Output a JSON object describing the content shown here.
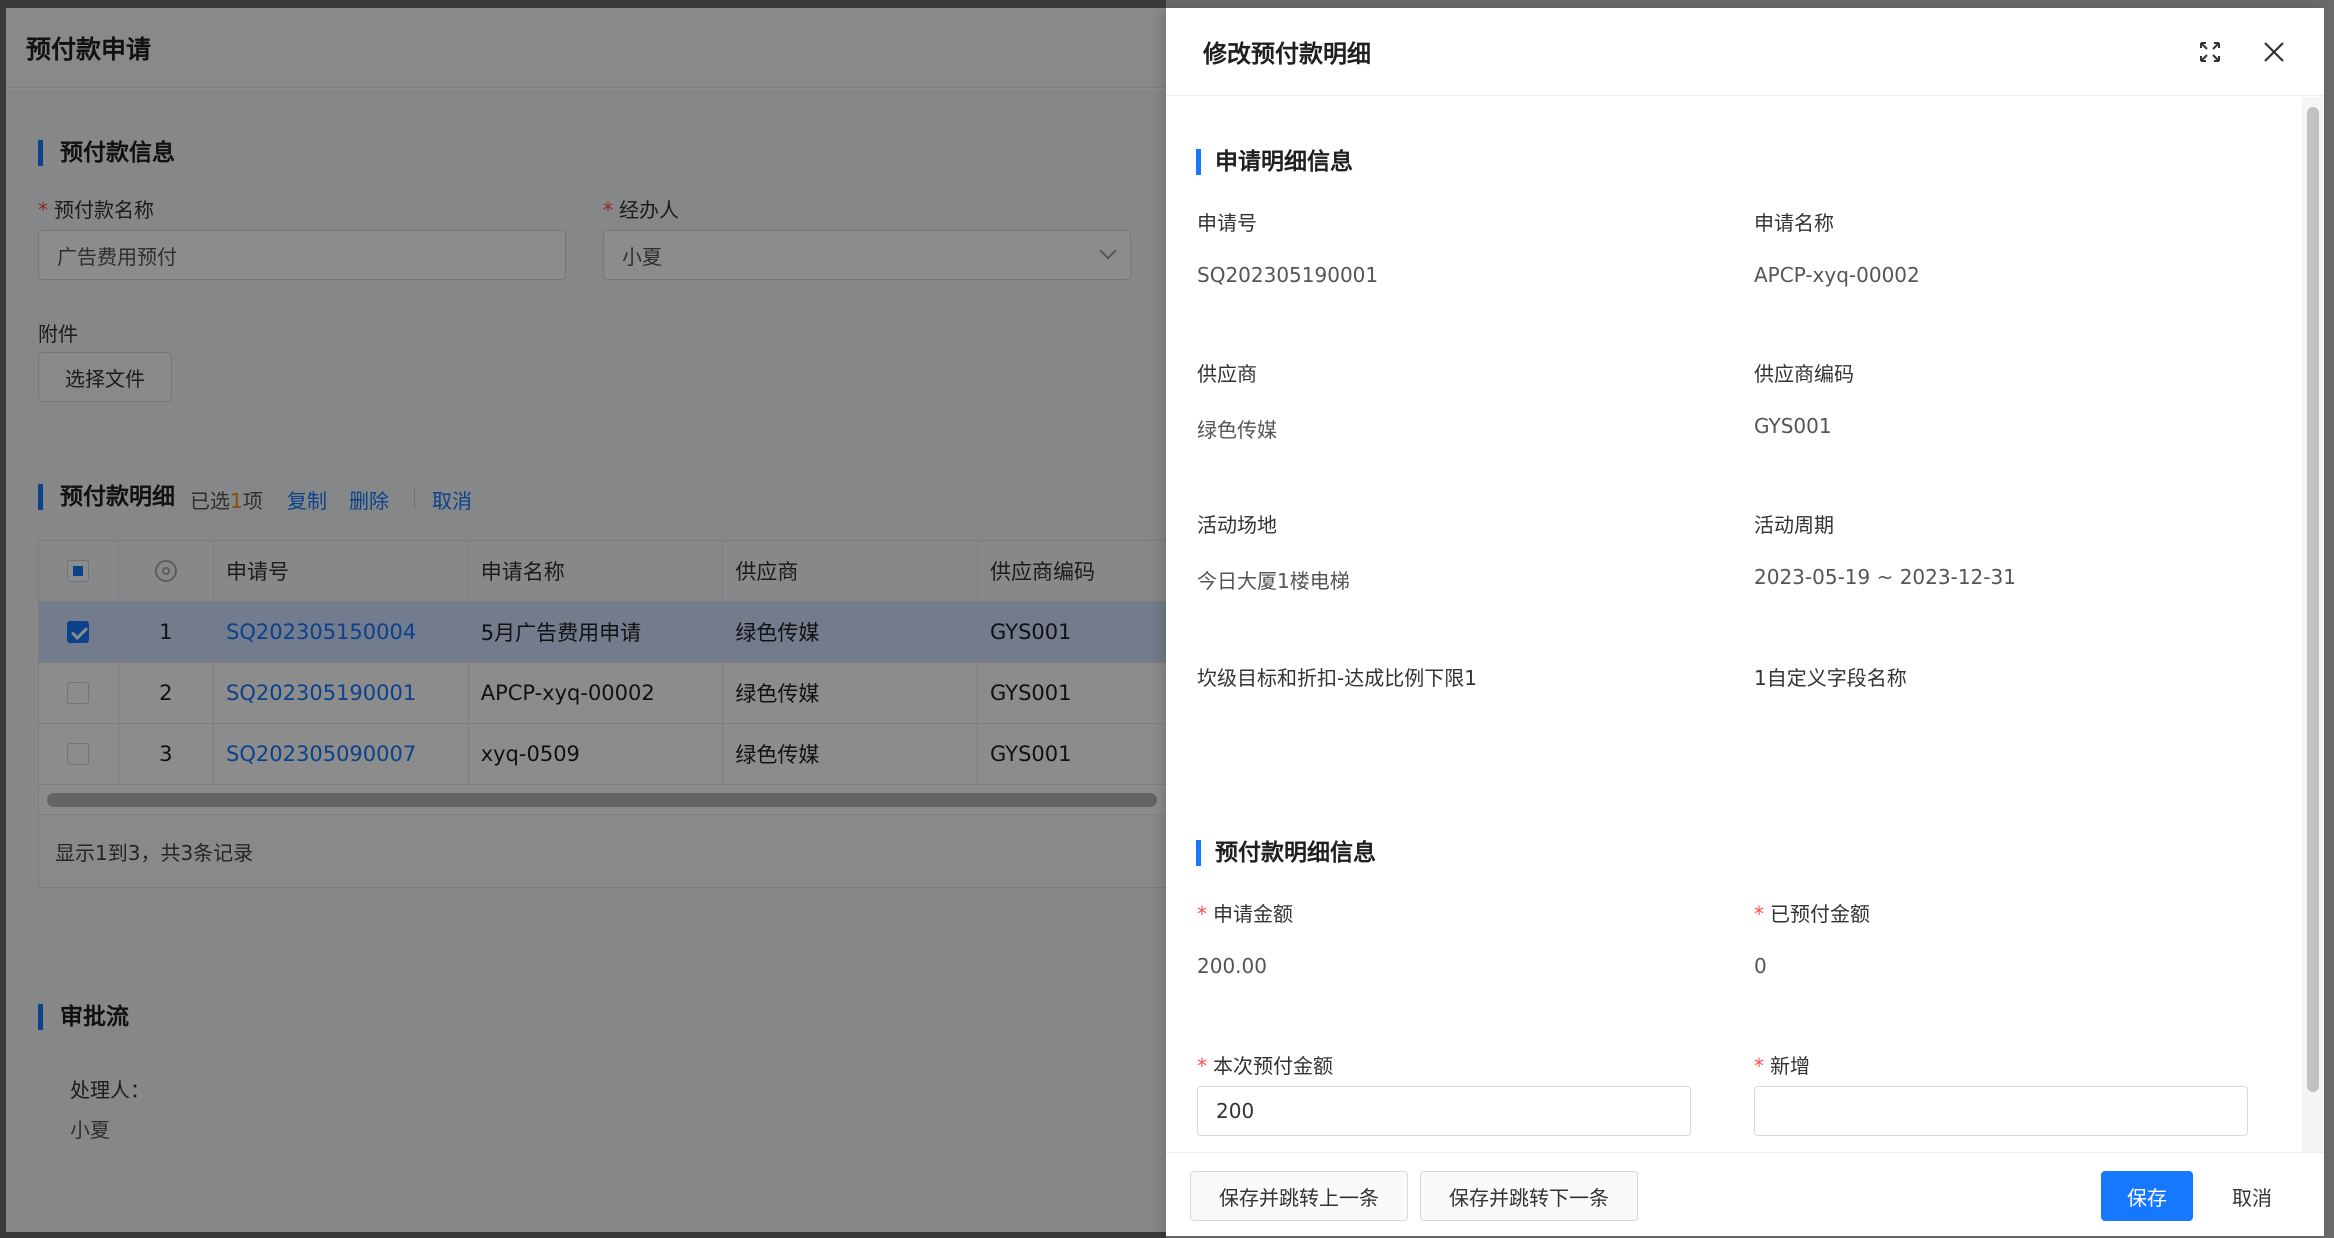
{
  "page": {
    "title": "预付款申请",
    "info_section": "预付款信息",
    "name_label": "预付款名称",
    "name_value": "广告费用预付",
    "handler_label": "经办人",
    "handler_value": "小夏",
    "attach_label": "附件",
    "attach_button": "选择文件",
    "detail_section": "预付款明细",
    "selected_prefix": "已选",
    "selected_count": "1",
    "selected_suffix": "项",
    "copy_link": "复制",
    "delete_link": "删除",
    "cancel_link": "取消",
    "table": {
      "headers": [
        "申请号",
        "申请名称",
        "供应商",
        "供应商编码"
      ],
      "rows": [
        {
          "no": "1",
          "id": "SQ202305150004",
          "name": "5月广告费用申请",
          "supplier": "绿色传媒",
          "code": "GYS001",
          "checked": true
        },
        {
          "no": "2",
          "id": "SQ202305190001",
          "name": "APCP-xyq-00002",
          "supplier": "绿色传媒",
          "code": "GYS001",
          "checked": false
        },
        {
          "no": "3",
          "id": "SQ202305090007",
          "name": "xyq-0509",
          "supplier": "绿色传媒",
          "code": "GYS001",
          "checked": false
        }
      ],
      "footer": "显示1到3，共3条记录"
    },
    "approval_section": "审批流",
    "processor_label": "处理人：",
    "processor_value": "小夏"
  },
  "drawer": {
    "title": "修改预付款明细",
    "section1": "申请明细信息",
    "fields1": {
      "apply_no_label": "申请号",
      "apply_no": "SQ202305190001",
      "apply_name_label": "申请名称",
      "apply_name": "APCP-xyq-00002",
      "supplier_label": "供应商",
      "supplier": "绿色传媒",
      "supplier_code_label": "供应商编码",
      "supplier_code": "GYS001",
      "venue_label": "活动场地",
      "venue": "今日大厦1楼电梯",
      "period_label": "活动周期",
      "period": "2023-05-19 ~ 2023-12-31",
      "custom1_label": "坎级目标和折扣-达成比例下限1",
      "custom2_label": "1自定义字段名称"
    },
    "section2": "预付款明细信息",
    "fields2": {
      "apply_amount_label": "申请金额",
      "apply_amount": "200.00",
      "prepaid_label": "已预付金额",
      "prepaid": "0",
      "current_label": "本次预付金额",
      "current_value": "200",
      "new_label": "新增",
      "new_value": ""
    },
    "buttons": {
      "prev": "保存并跳转上一条",
      "next": "保存并跳转下一条",
      "save": "保存",
      "cancel": "取消"
    }
  },
  "colors": {
    "accent": "#1677ff",
    "required": "#ff4d4f",
    "selected_row": "#cfe2ff"
  }
}
